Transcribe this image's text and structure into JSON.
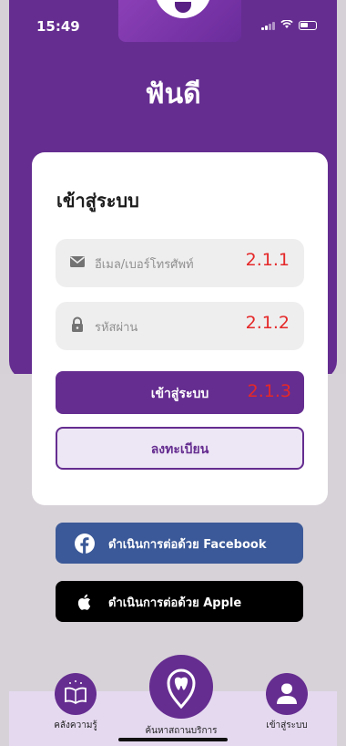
{
  "status": {
    "time": "15:49"
  },
  "app": {
    "title": "ฟันดี"
  },
  "login": {
    "title": "เข้าสู่ระบบ",
    "email_placeholder": "อีเมล/เบอร์โทรศัพท์",
    "email_annotation": "2.1.1",
    "password_placeholder": "รหัสผ่าน",
    "password_annotation": "2.1.2",
    "login_button": "เข้าสู่ระบบ",
    "login_annotation": "2.1.3",
    "register_button": "ลงทะเบียน"
  },
  "social": {
    "facebook_label": "ดำเนินการต่อด้วย Facebook",
    "apple_label": "ดำเนินการต่อด้วย Apple"
  },
  "nav": {
    "items": [
      {
        "label": "คลังความรู้",
        "icon": "book-icon"
      },
      {
        "label": "ค้นหาสถานบริการ",
        "icon": "tooth-location-icon"
      },
      {
        "label": "เข้าสู่ระบบ",
        "icon": "user-icon"
      }
    ]
  },
  "colors": {
    "primary": "#652d90",
    "facebook": "#3b5998",
    "annotation": "#e52828"
  }
}
